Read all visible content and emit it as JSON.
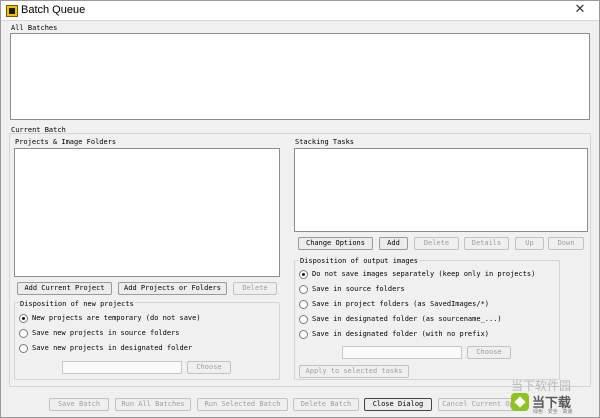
{
  "window": {
    "title": "Batch Queue",
    "close_glyph": "✕"
  },
  "all_batches": {
    "label": "All Batches"
  },
  "current_batch": {
    "label": "Current Batch",
    "projects": {
      "label": "Projects & Image Folders",
      "add_current_project": "Add Current Project",
      "add_projects_or_folders": "Add Projects or Folders",
      "delete": "Delete"
    },
    "disposition_new": {
      "label": "Disposition of new projects",
      "options": [
        {
          "label": "New projects are temporary (do not save)",
          "selected": true
        },
        {
          "label": "Save new projects in source folders",
          "selected": false
        },
        {
          "label": "Save new projects in designated folder",
          "selected": false
        }
      ],
      "choose": "Choose"
    },
    "stacking_tasks": {
      "label": "Stacking Tasks",
      "buttons": [
        "Change Options",
        "Add",
        "Delete",
        "Details",
        "Up",
        "Down"
      ]
    },
    "disposition_output": {
      "label": "Disposition of output images",
      "options": [
        {
          "label": "Do not save images separately (keep only in projects)",
          "selected": true
        },
        {
          "label": "Save in source folders",
          "selected": false
        },
        {
          "label": "Save in project folders (as SavedImages/*)",
          "selected": false
        },
        {
          "label": "Save in designated folder (as sourcename_...)",
          "selected": false
        },
        {
          "label": "Save in designated folder (with no prefix)",
          "selected": false
        }
      ],
      "choose": "Choose",
      "apply": "Apply to selected tasks"
    }
  },
  "footer": {
    "save_batch": "Save Batch",
    "run_all_batches": "Run All Batches",
    "run_selected_batch": "Run Selected Batch",
    "delete_batch": "Delete Batch",
    "close_dialog": "Close Dialog",
    "cancel_current_op": "Cancel Current Op"
  },
  "watermark": {
    "top": "当下软件园",
    "big": "当下载",
    "small": "绿色 · 安全 · 高速"
  }
}
